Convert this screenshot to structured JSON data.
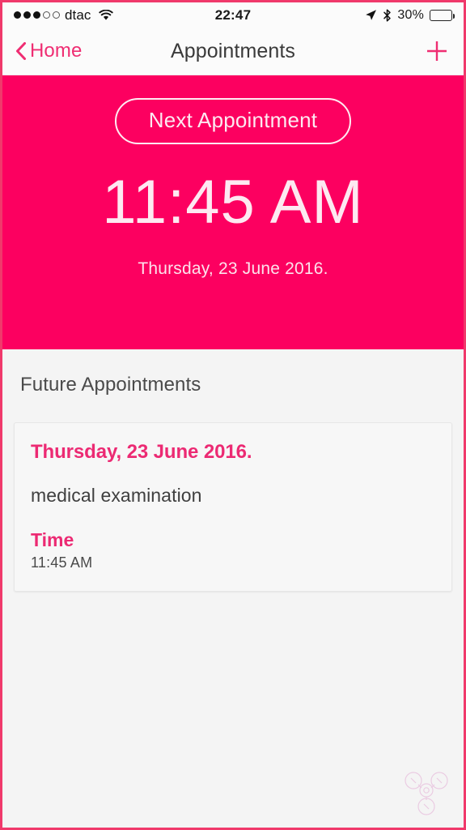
{
  "statusbar": {
    "signal_filled": 3,
    "signal_empty": 2,
    "carrier": "dtac",
    "wifi_icon": "wifi-icon",
    "time": "22:47",
    "location_icon": "location-arrow-icon",
    "bluetooth_icon": "bluetooth-icon",
    "battery_percent": "30%",
    "battery_level": 30
  },
  "navbar": {
    "back_icon": "chevron-left-icon",
    "back_label": "Home",
    "title": "Appointments",
    "add_icon": "plus-icon"
  },
  "hero": {
    "badge_label": "Next Appointment",
    "time": "11:45 AM",
    "date": "Thursday, 23 June 2016.",
    "background_color": "#fc0060",
    "text_color": "#fde9f1"
  },
  "list": {
    "section_title": "Future Appointments",
    "appointments": [
      {
        "date": "Thursday, 23 June 2016.",
        "description": "medical examination",
        "time_label": "Time",
        "time_value": "11:45 AM"
      }
    ]
  },
  "watermark": {
    "icon": "watermark-logo-icon"
  },
  "colors": {
    "accent": "#ec2a73",
    "hero": "#fc0060",
    "page_background": "#f4f4f4",
    "card_background": "#f7f7f7",
    "frame_border": "#f0396b"
  }
}
